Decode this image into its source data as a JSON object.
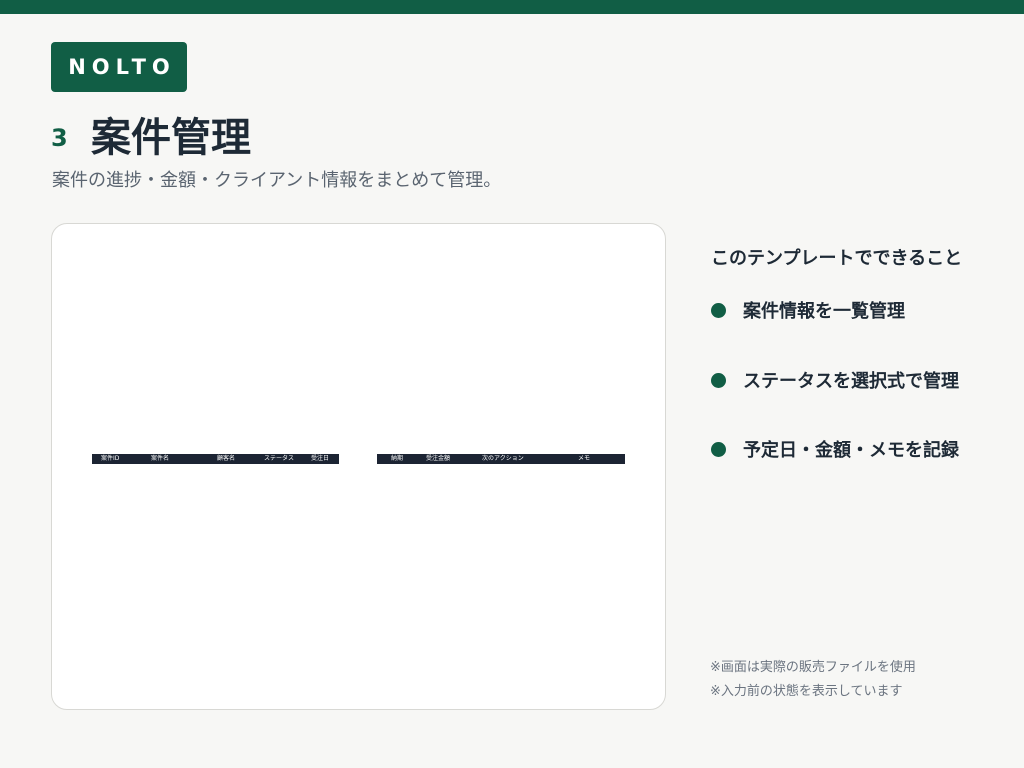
{
  "brand": {
    "logo_text": "NOLTO",
    "accent_color": "#115e45"
  },
  "header": {
    "section_number": "3",
    "title": "案件管理",
    "subtitle": "案件の進捗・金額・クライアント情報をまとめて管理。"
  },
  "preview": {
    "left_table_headers": [
      "案件ID",
      "案件名",
      "顧客名",
      "ステータス",
      "受注日"
    ],
    "right_table_headers": [
      "納期",
      "受注金額",
      "次のアクション",
      "メモ"
    ]
  },
  "features": {
    "heading": "このテンプレートでできること",
    "items": [
      "案件情報を一覧管理",
      "ステータスを選択式で管理",
      "予定日・金額・メモを記録"
    ]
  },
  "notes": [
    "※画面は実際の販売ファイルを使用",
    "※入力前の状態を表示しています"
  ]
}
